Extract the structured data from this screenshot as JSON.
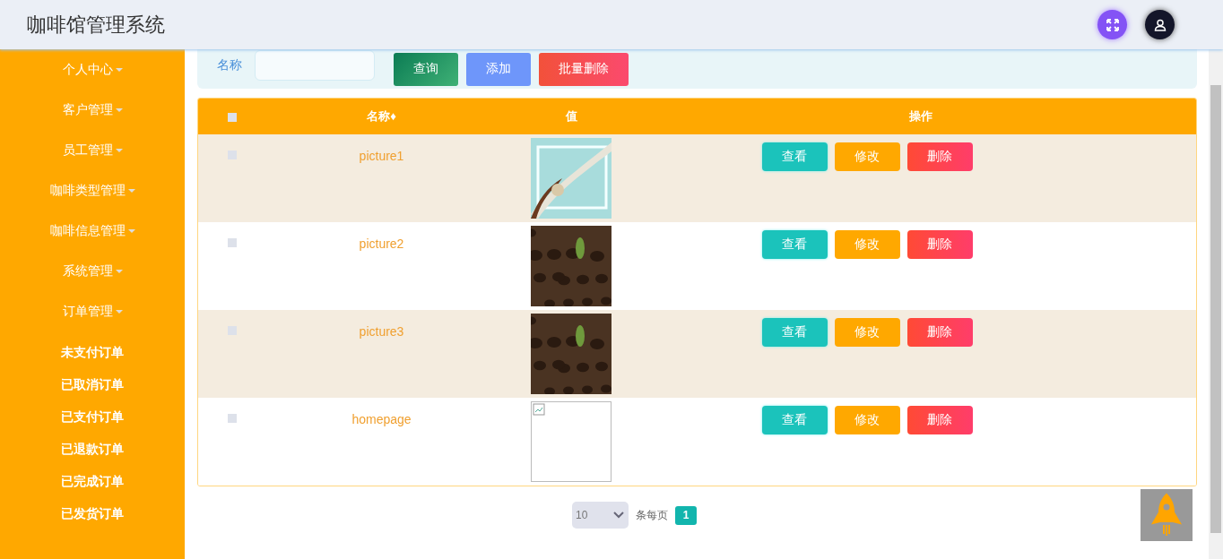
{
  "header": {
    "title": "咖啡馆管理系统"
  },
  "sidebar": {
    "items": [
      {
        "label": "个人中心"
      },
      {
        "label": "客户管理"
      },
      {
        "label": "员工管理"
      },
      {
        "label": "咖啡类型管理"
      },
      {
        "label": "咖啡信息管理"
      },
      {
        "label": "系统管理"
      },
      {
        "label": "订单管理",
        "children": [
          {
            "label": "未支付订单"
          },
          {
            "label": "已取消订单"
          },
          {
            "label": "已支付订单"
          },
          {
            "label": "已退款订单"
          },
          {
            "label": "已完成订单"
          },
          {
            "label": "已发货订单"
          }
        ]
      }
    ]
  },
  "search": {
    "label": "名称",
    "buttons": [
      {
        "label": "查询",
        "kind": "search"
      },
      {
        "label": "添加",
        "kind": "add"
      },
      {
        "label": "批量删除",
        "kind": "delete"
      }
    ]
  },
  "table": {
    "select_all_checked": false,
    "columns": [
      "名称",
      "值",
      "操作"
    ],
    "sort_mark": "♦",
    "rows": [
      {
        "checked": false,
        "name": "picture1",
        "value": {
          "kind": "poster"
        },
        "actions": [
          "查看",
          "修改",
          "删除"
        ]
      },
      {
        "checked": false,
        "name": "picture2",
        "value": {
          "kind": "beans"
        },
        "actions": [
          "查看",
          "修改",
          "删除"
        ]
      },
      {
        "checked": false,
        "name": "picture3",
        "value": {
          "kind": "beans"
        },
        "actions": [
          "查看",
          "修改",
          "删除"
        ]
      },
      {
        "checked": false,
        "name": "homepage",
        "value": {
          "kind": "broken"
        },
        "actions": [
          "查看",
          "修改",
          "删除"
        ]
      }
    ]
  },
  "pagination": {
    "page_size": "10",
    "per_page_label": "条每页",
    "pages": [
      {
        "label": "1",
        "selected": true
      }
    ]
  }
}
